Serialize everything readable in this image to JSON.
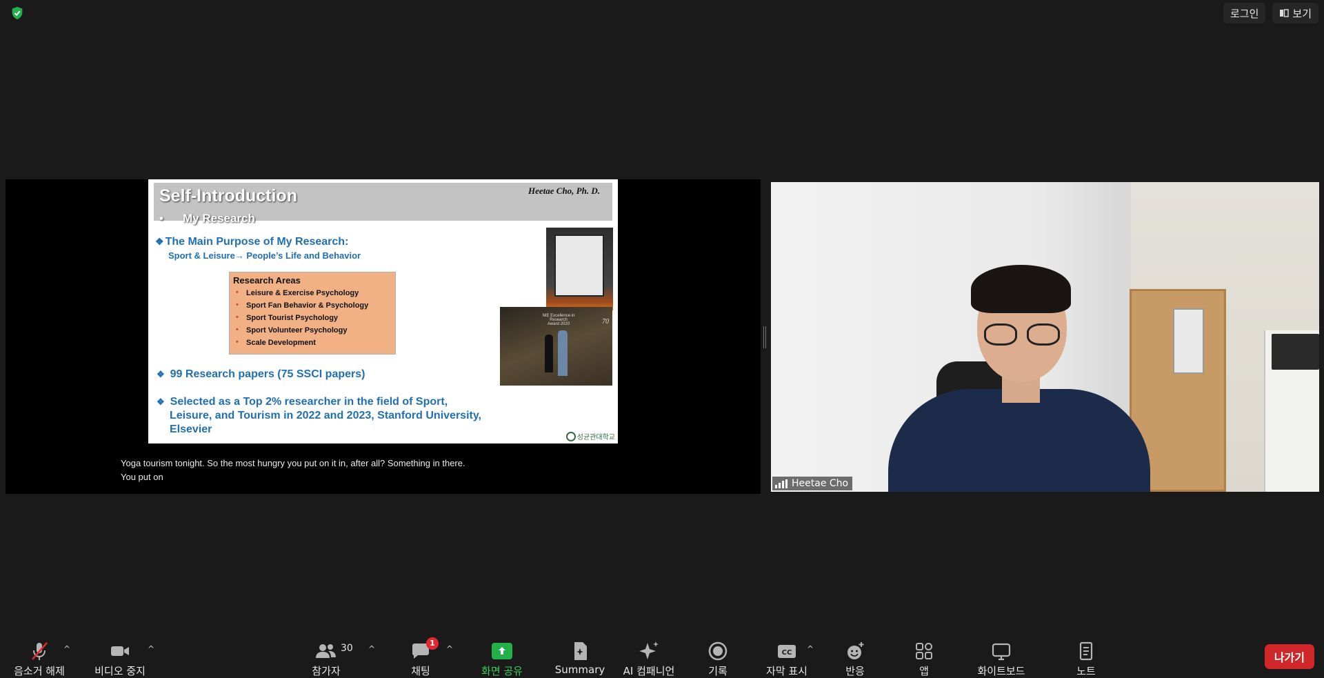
{
  "top_bar": {
    "security_icon": "shield-check-icon",
    "security_color": "#23b04a",
    "login_label": "로그인",
    "view_label": "보기"
  },
  "shared_screen": {
    "slide": {
      "title": "Self-Introduction",
      "subtitle_bullet": "•",
      "subtitle": "My Research",
      "author": "Heetae Cho, Ph. D.",
      "purpose_title": "The Main Purpose of My Research:",
      "purpose_detail": "Sport  & Leisure→ People’s Life and Behavior",
      "research_areas_title": "Research Areas",
      "research_areas": [
        "Leisure & Exercise Psychology",
        "Sport Fan Behavior & Psychology",
        "Sport Tourist Psychology",
        "Sport Volunteer Psychology",
        "Scale Development"
      ],
      "papers": "99 Research papers (75 SSCI papers)",
      "top_researcher_line1": "Selected as a Top 2% researcher in the field of Sport,",
      "top_researcher_line2": "Leisure, and Tourism in 2022 and 2023, Stanford University,",
      "top_researcher_line3": "Elsevier",
      "photo_caption_line1": "NIE Excellence in Research",
      "photo_caption_line2": "Award 2020",
      "photo_badge": "70",
      "university_logo": "성균관대학교"
    },
    "captions": [
      "Yoga tourism tonight. So the most hungry you put on it in, after all? Something in there.",
      "You put on"
    ]
  },
  "video": {
    "participant_name": "Heetae Cho"
  },
  "toolbar": {
    "mute_label": "음소거 해제",
    "video_label": "비디오 중지",
    "participants_label": "참가자",
    "participants_count": "30",
    "chat_label": "채팅",
    "chat_badge": "1",
    "share_label": "화면 공유",
    "summary_label": "Summary",
    "ai_label": "AI 컴패니언",
    "record_label": "기록",
    "captions_label": "자막 표시",
    "captions_icon_text": "CC",
    "reactions_label": "반응",
    "apps_label": "앱",
    "whiteboard_label": "화이트보드",
    "notes_label": "노트",
    "leave_label": "나가기",
    "leave_color": "#d0272b",
    "share_color": "#23b04a"
  }
}
